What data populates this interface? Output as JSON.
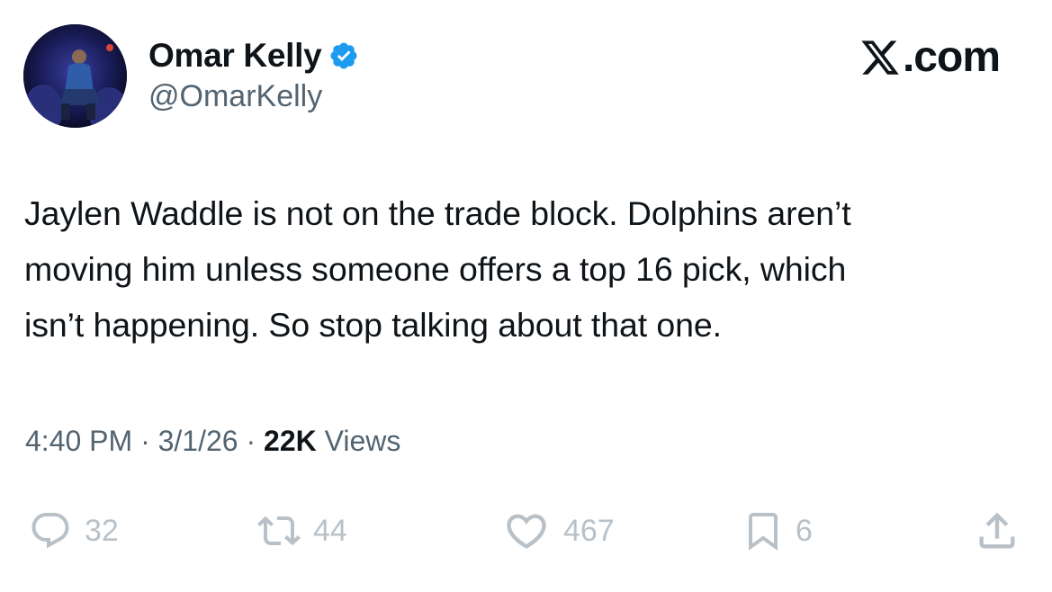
{
  "author": {
    "display_name": "Omar Kelly",
    "handle": "@OmarKelly",
    "verified": true
  },
  "brand": {
    "label": ".com",
    "logo_icon": "x-logo-icon"
  },
  "tweet": {
    "text_lines": [
      "Jaylen Waddle is not on the trade block. Dolphins aren’t",
      "moving him unless someone offers a top 16 pick, which",
      "isn’t happening. So stop talking about that one."
    ]
  },
  "meta": {
    "time": "4:40 PM",
    "separator1": " · ",
    "date": "3/1/26",
    "separator2": " · ",
    "views_count": "22K",
    "views_label": " Views"
  },
  "actions": {
    "replies": "32",
    "reposts": "44",
    "likes": "467",
    "bookmarks": "6"
  },
  "colors": {
    "text": "#0f1419",
    "secondary": "#536471",
    "action_gray": "#b9c1c8",
    "verified_blue": "#1d9bf0"
  }
}
